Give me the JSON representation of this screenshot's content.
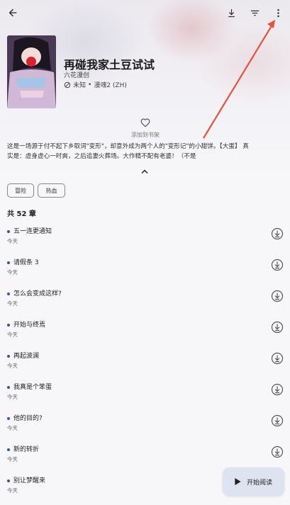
{
  "header": {
    "back_icon": "arrow-back-icon",
    "download_icon": "download-icon",
    "filter_icon": "filter-icon",
    "more_icon": "more-vert-icon"
  },
  "manga": {
    "title": "再碰我家土豆试试",
    "author": "六花漫创",
    "status": "未知",
    "source": "漫魂2 (ZH)",
    "status_icon": "blocked-icon",
    "favorite_icon": "heart-outline-icon",
    "favorite_label": "添加到书架",
    "description_line1": "这是一场源于付不起下乡取词\"变形\"，却意外成为两个人的\"变形记\"的小甜饼。【大蛋】 真",
    "description_line2": "实是：虚身虚心一时爽，之后追妻火葬场。大作精不配有老婆！（不是",
    "expand_icon": "chevron-up-icon",
    "tags": [
      "冒险",
      "热血"
    ]
  },
  "chapters": {
    "count_label": "共 52 章",
    "items": [
      {
        "title": "五一连更通知",
        "date": "今天"
      },
      {
        "title": "请假条 3",
        "date": "今天"
      },
      {
        "title": "怎么会变成这样?",
        "date": "今天"
      },
      {
        "title": "开始与终焉",
        "date": "今天"
      },
      {
        "title": "再起波澜",
        "date": "今天"
      },
      {
        "title": "我真是个笨蛋",
        "date": "今天"
      },
      {
        "title": "他的目的?",
        "date": "今天"
      },
      {
        "title": "新的转折",
        "date": "今天"
      },
      {
        "title": "别让梦醒来",
        "date": "今天"
      }
    ],
    "download_icon": "download-circle-icon"
  },
  "fab": {
    "label": "开始阅读",
    "icon": "play-icon"
  },
  "colors": {
    "accent": "#2c5aa0",
    "fab_bg": "#dde3f1",
    "annotation_arrow": "#e4533c"
  }
}
